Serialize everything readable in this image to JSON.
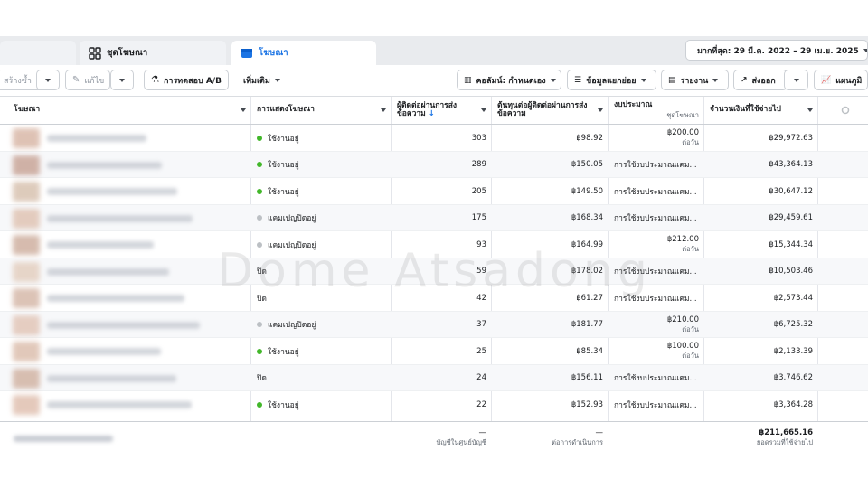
{
  "tabs": [
    {
      "label": ""
    },
    {
      "label": "ชุดโฆษณา"
    },
    {
      "label": "โฆษณา"
    }
  ],
  "date_range": "มากที่สุด: 29 มี.ค. 2022 – 29 เม.ย. 2025",
  "toolbar": {
    "duplicate": "สร้างซ้ำ",
    "edit": "แก้ไข",
    "ab_test": "การทดสอบ A/B",
    "more": "เพิ่มเติม",
    "columns": "คอลัมน์: กำหนดเอง",
    "breakdown": "ข้อมูลแยกย่อย",
    "reports": "รายงาน",
    "export": "ส่งออก",
    "charts": "แผนภูมิ"
  },
  "columns": {
    "ad": "โฆษณา",
    "delivery": "การแสดงโฆษณา",
    "messaging": "ผู้ติดต่อผ่านการส่งข้อความ",
    "cost_per_messaging": "ต้นทุนต่อผู้ติดต่อผ่านการส่งข้อความ",
    "budget": "งบประมาณ",
    "budget_sub": "ชุดโฆษณา",
    "amount_spent": "จำนวนเงินที่ใช้จ่ายไป"
  },
  "status_colors": {
    "active": "#42b72a",
    "off": "#bcc0c4"
  },
  "rows": [
    {
      "status": "ใช้งานอยู่",
      "state": "active",
      "results": "303",
      "cost": "฿98.92",
      "budget": "฿200.00",
      "budget_sub": "ต่อวัน",
      "spent": "฿29,972.63",
      "thumb": "#d9b8a8"
    },
    {
      "status": "ใช้งานอยู่",
      "state": "active",
      "results": "289",
      "cost": "฿150.05",
      "budget": "การใช้งบประมาณแคม...",
      "budget_sub": "",
      "spent": "฿43,364.13",
      "thumb": "#c9a598"
    },
    {
      "status": "ใช้งานอยู่",
      "state": "active",
      "results": "205",
      "cost": "฿149.50",
      "budget": "การใช้งบประมาณแคม...",
      "budget_sub": "",
      "spent": "฿30,647.12",
      "thumb": "#d8c2b0"
    },
    {
      "status": "แคมเปญปิดอยู่",
      "state": "off",
      "results": "175",
      "cost": "฿168.34",
      "budget": "การใช้งบประมาณแคม...",
      "budget_sub": "",
      "spent": "฿29,459.61",
      "thumb": "#e0c4b4"
    },
    {
      "status": "แคมเปญปิดอยู่",
      "state": "off",
      "results": "93",
      "cost": "฿164.99",
      "budget": "฿212.00",
      "budget_sub": "ต่อวัน",
      "spent": "฿15,344.34",
      "thumb": "#cfb0a0"
    },
    {
      "status": "ปิด",
      "state": "none",
      "results": "59",
      "cost": "฿178.02",
      "budget": "การใช้งบประมาณแคม...",
      "budget_sub": "",
      "spent": "฿10,503.46",
      "thumb": "#e4cfc0"
    },
    {
      "status": "ปิด",
      "state": "none",
      "results": "42",
      "cost": "฿61.27",
      "budget": "การใช้งบประมาณแคม...",
      "budget_sub": "",
      "spent": "฿2,573.44",
      "thumb": "#d6b9aa"
    },
    {
      "status": "แคมเปญปิดอยู่",
      "state": "off",
      "results": "37",
      "cost": "฿181.77",
      "budget": "฿210.00",
      "budget_sub": "ต่อวัน",
      "spent": "฿6,725.32",
      "thumb": "#e2c6b8"
    },
    {
      "status": "ใช้งานอยู่",
      "state": "active",
      "results": "25",
      "cost": "฿85.34",
      "budget": "฿100.00",
      "budget_sub": "ต่อวัน",
      "spent": "฿2,133.39",
      "thumb": "#dcbfae"
    },
    {
      "status": "ปิด",
      "state": "none",
      "results": "24",
      "cost": "฿156.11",
      "budget": "การใช้งบประมาณแคม...",
      "budget_sub": "",
      "spent": "฿3,746.62",
      "thumb": "#d2b4a4"
    },
    {
      "status": "ใช้งานอยู่",
      "state": "active",
      "results": "22",
      "cost": "฿152.93",
      "budget": "การใช้งบประมาณแคม...",
      "budget_sub": "",
      "spent": "฿3,364.28",
      "thumb": "#e0c0b0"
    }
  ],
  "footer": {
    "results_dash": "—",
    "results_sub": "บัญชีในศูนย์บัญชี",
    "cost_dash": "—",
    "cost_sub": "ต่อการดำเนินการ",
    "total_spent": "฿211,665.16",
    "total_sub": "ยอดรวมที่ใช้จ่ายไป"
  },
  "watermark": "Dome Atsadong"
}
